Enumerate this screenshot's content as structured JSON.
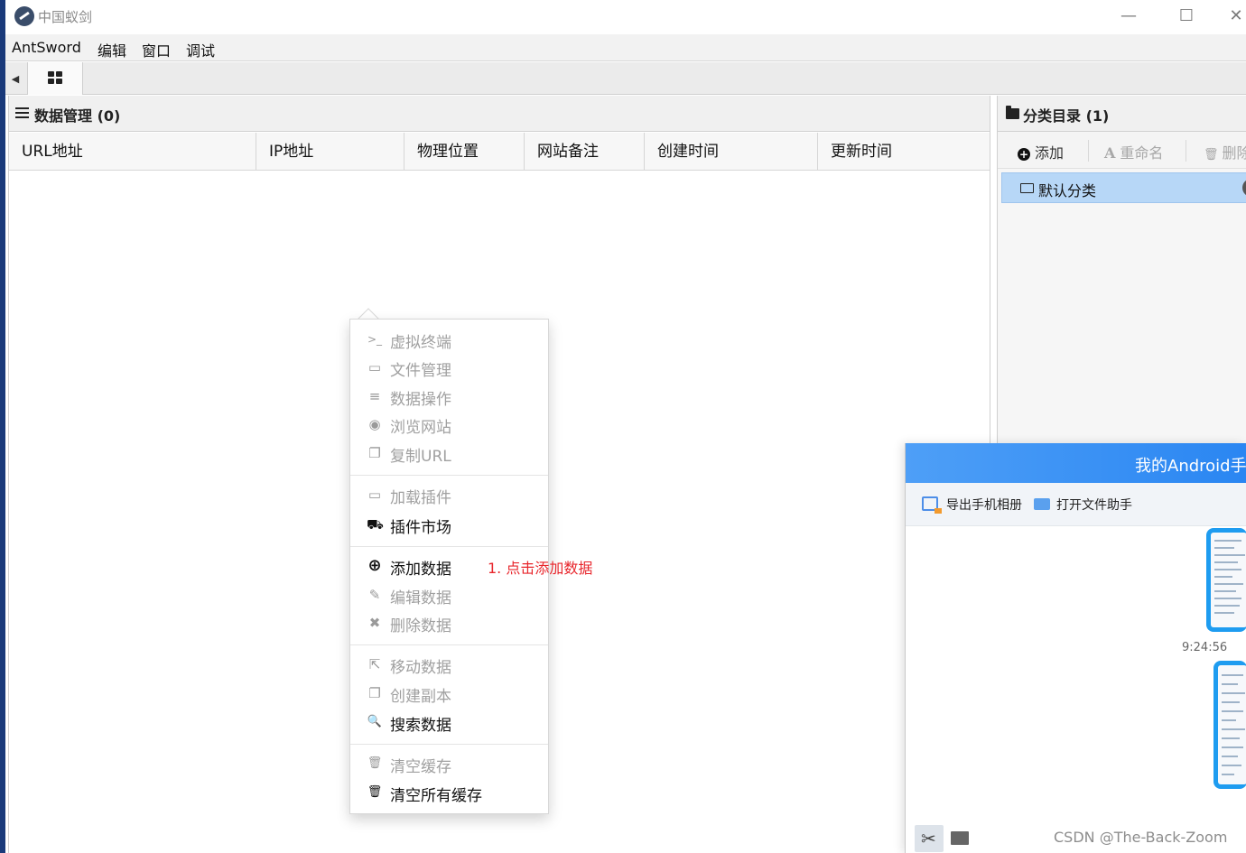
{
  "window": {
    "title": "中国蚁剑",
    "controls": {
      "minimize": "—",
      "maximize": "☐",
      "close": "✕"
    }
  },
  "menubar": {
    "items": [
      "AntSword",
      "编辑",
      "窗口",
      "调试"
    ]
  },
  "tabs": {
    "home_icon": "grid-icon",
    "back_arrow": "◀"
  },
  "data_panel": {
    "title": "数据管理 (0)",
    "columns": [
      "URL地址",
      "IP地址",
      "物理位置",
      "网站备注",
      "创建时间",
      "更新时间"
    ]
  },
  "category_panel": {
    "title": "分类目录 (1)",
    "toolbar": {
      "add": "添加",
      "rename_icon": "A",
      "rename": "重命名",
      "delete_icon": "🗑",
      "delete": "删除"
    },
    "categories": [
      {
        "label": "默认分类"
      }
    ]
  },
  "context_menu": {
    "items": [
      {
        "icon": "terminal-icon",
        "glyph": ">_",
        "label": "虚拟终端",
        "enabled": false
      },
      {
        "icon": "folder-icon",
        "glyph": "▭",
        "label": "文件管理",
        "enabled": false
      },
      {
        "icon": "database-icon",
        "glyph": "≡",
        "label": "数据操作",
        "enabled": false
      },
      {
        "icon": "chrome-icon",
        "glyph": "◉",
        "label": "浏览网站",
        "enabled": false
      },
      {
        "icon": "copy-icon",
        "glyph": "❐",
        "label": "复制URL",
        "enabled": false
      },
      {
        "icon": "folder-icon",
        "glyph": "▭",
        "label": "加载插件",
        "enabled": false
      },
      {
        "icon": "cart-icon",
        "glyph": "⛟",
        "label": "插件市场",
        "enabled": true
      },
      {
        "icon": "plus-circle-icon",
        "glyph": "⊕",
        "label": "添加数据",
        "enabled": true
      },
      {
        "icon": "edit-icon",
        "glyph": "✎",
        "label": "编辑数据",
        "enabled": false
      },
      {
        "icon": "close-icon",
        "glyph": "✖",
        "label": "删除数据",
        "enabled": false
      },
      {
        "icon": "share-icon",
        "glyph": "⇱",
        "label": "移动数据",
        "enabled": false
      },
      {
        "icon": "copy-icon",
        "glyph": "❐",
        "label": "创建副本",
        "enabled": false
      },
      {
        "icon": "search-icon",
        "glyph": "🔍",
        "label": "搜索数据",
        "enabled": true
      },
      {
        "icon": "trash-icon",
        "glyph": "🗑",
        "label": "清空缓存",
        "enabled": false
      },
      {
        "icon": "trash-icon",
        "glyph": "🗑",
        "label": "清空所有缓存",
        "enabled": true
      }
    ],
    "annotation": "1. 点击添加数据"
  },
  "android_window": {
    "title": "我的Android手",
    "toolbar": {
      "export_album": "导出手机相册",
      "open_helper": "打开文件助手"
    },
    "timestamp": "9:24:56",
    "cut_icon": "✂",
    "watermark": "CSDN @The-Back-Zoom"
  },
  "colors": {
    "accent": "#2a86f2",
    "selection": "#b7d7f7",
    "annotation": "#e8262c",
    "disabled_text": "#a0a0a0"
  }
}
